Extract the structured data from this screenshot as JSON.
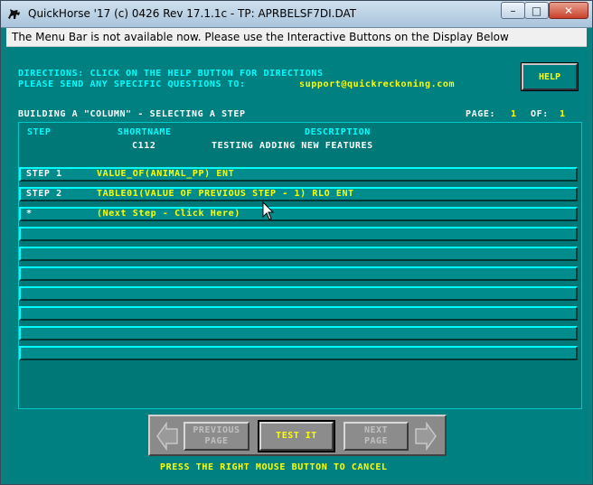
{
  "window": {
    "title": "QuickHorse '17 (c) 0426 Rev 17.1.1c - TP: APRBELSF7DI.DAT",
    "close_label": "✕",
    "max_label": "□",
    "min_label": "–"
  },
  "menubar": {
    "message": "The Menu Bar is not available now.  Please use the Interactive Buttons on the Display Below"
  },
  "directions": {
    "line1": "DIRECTIONS:  CLICK ON THE HELP BUTTON FOR DIRECTIONS",
    "line2_prefix": "PLEASE SEND ANY SPECIFIC QUESTIONS TO:",
    "email": "support@quickreckoning.com"
  },
  "help_button": {
    "label": "HELP"
  },
  "header": {
    "building": "BUILDING A \"COLUMN\" - SELECTING A STEP",
    "page_label": "PAGE:",
    "page": "1",
    "of_label": "OF:",
    "of": "1"
  },
  "columns": {
    "step": "STEP",
    "shortname": "SHORTNAME",
    "description": "DESCRIPTION"
  },
  "column_info": {
    "shortname": "C112",
    "description": "TESTING ADDING NEW FEATURES"
  },
  "rows": [
    {
      "step": "STEP 1",
      "text": "VALUE_OF(ANIMAL_PP) ENT"
    },
    {
      "step": "STEP 2",
      "text": "TABLE01(VALUE OF PREVIOUS STEP - 1) RLO ENT"
    },
    {
      "step": "*",
      "text": "(Next Step - Click Here)"
    },
    {
      "step": "",
      "text": ""
    },
    {
      "step": "",
      "text": ""
    },
    {
      "step": "",
      "text": ""
    },
    {
      "step": "",
      "text": ""
    },
    {
      "step": "",
      "text": ""
    },
    {
      "step": "",
      "text": ""
    },
    {
      "step": "",
      "text": ""
    }
  ],
  "nav": {
    "prev_line1": "PREVIOUS",
    "prev_line2": "PAGE",
    "test_label": "TEST IT",
    "next_line1": "NEXT",
    "next_line2": "PAGE"
  },
  "footer": {
    "cancel_hint": "PRESS THE RIGHT MOUSE BUTTON TO CANCEL"
  },
  "colors": {
    "teal": "#008080",
    "yellow": "#ffff00",
    "cyan": "#00ffff"
  }
}
